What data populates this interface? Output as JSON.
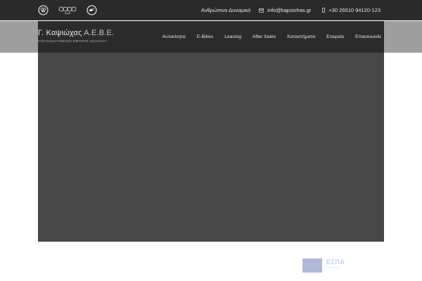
{
  "topbar": {
    "brands": [
      {
        "name": "volkswagen",
        "icon": "vw-logo-icon"
      },
      {
        "name": "audi",
        "icon": "audi-logo-icon",
        "label": "Audi"
      },
      {
        "name": "skoda",
        "icon": "skoda-logo-icon"
      }
    ],
    "links": {
      "careers": "Ανθρώπινο Δυναμικό",
      "email": "info@kapsiohas.gr",
      "phone": "+30 26510 94120-123"
    }
  },
  "logo": {
    "title": "Γ. Καψιώχας",
    "suffix": "Α.Ε.Β.Ε.",
    "subtitle": "ΕΞΟΥΣΙΟΔΟΤΗΜΕΝΟΣ ΕΜΠΟΡΟΣ ΚΟΙΛΟΛΚΑΙ"
  },
  "menu": [
    "Αυτοκίνητα",
    "E-Bikes",
    "Leasing",
    "After Sales",
    "Καταστήματα",
    "Εταιρεία",
    "Επικοινωνία"
  ],
  "footer": {
    "espa_label": "ΕΣΠΑ",
    "espa_sub": "2014-2020"
  },
  "colors": {
    "topbar": "#2a2a2a",
    "navbar_outer": "#9e9e9e",
    "navbar_inner": "#2b2b2b",
    "hero": "#474747"
  }
}
